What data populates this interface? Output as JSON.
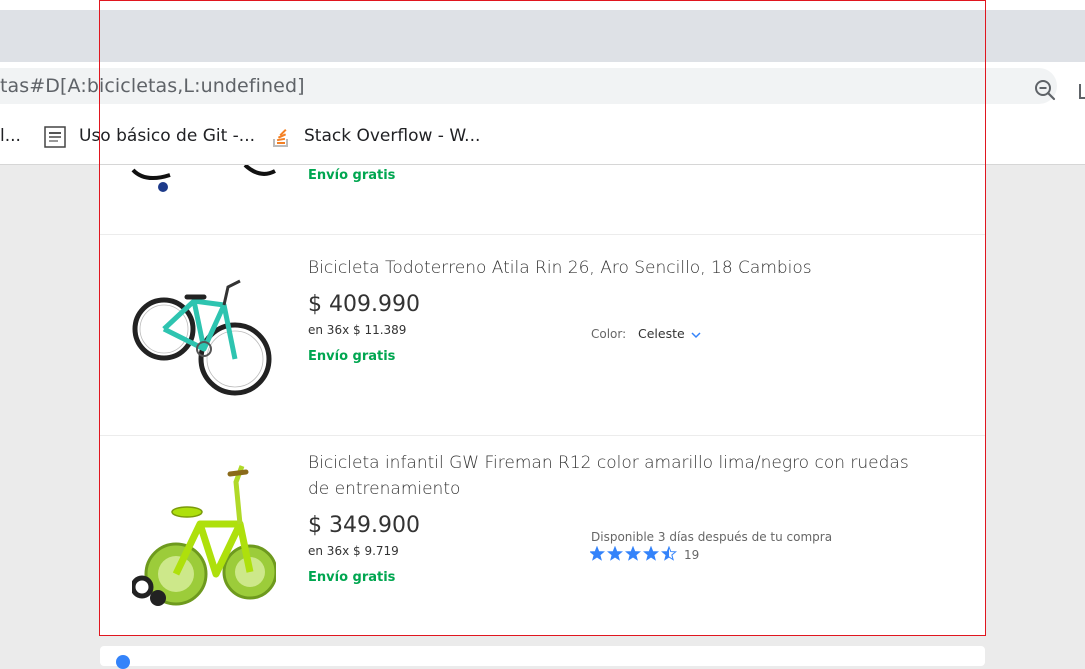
{
  "browser": {
    "url_text": "tas#D[A:bicicletas,L:undefined]",
    "zoom_icon": "zoom-out-icon",
    "bookmarks": [
      {
        "label": "l...",
        "icon": "bookmark-icon"
      },
      {
        "label": "Uso básico de Git -...",
        "icon": "git-doc-icon"
      },
      {
        "label": "Stack Overflow - W...",
        "icon": "stackoverflow-icon"
      }
    ]
  },
  "results": {
    "top_item": {
      "shipping": "Envío gratis"
    },
    "items": [
      {
        "title": "Bicicleta Todoterreno Atila Rin 26, Aro Sencillo, 18 Cambios",
        "price": "$ 409.990",
        "installments": "en 36x $ 11.389",
        "shipping": "Envío gratis",
        "color_label": "Color:",
        "color_value": "Celeste",
        "image": "teal-mountain-bike"
      },
      {
        "title_line1": "Bicicleta infantil GW Fireman R12 color amarillo lima/negro con ruedas",
        "title_line2": "de entrenamiento",
        "price": "$ 349.900",
        "installments": "en 36x $ 9.719",
        "shipping": "Envío gratis",
        "availability": "Disponible 3 días después de tu compra",
        "rating": 4.5,
        "reviews": "19",
        "image": "lime-kids-bike"
      }
    ]
  },
  "colors": {
    "free_shipping": "#00a650",
    "link_blue": "#3483fa",
    "selection_border": "#e0161f"
  }
}
